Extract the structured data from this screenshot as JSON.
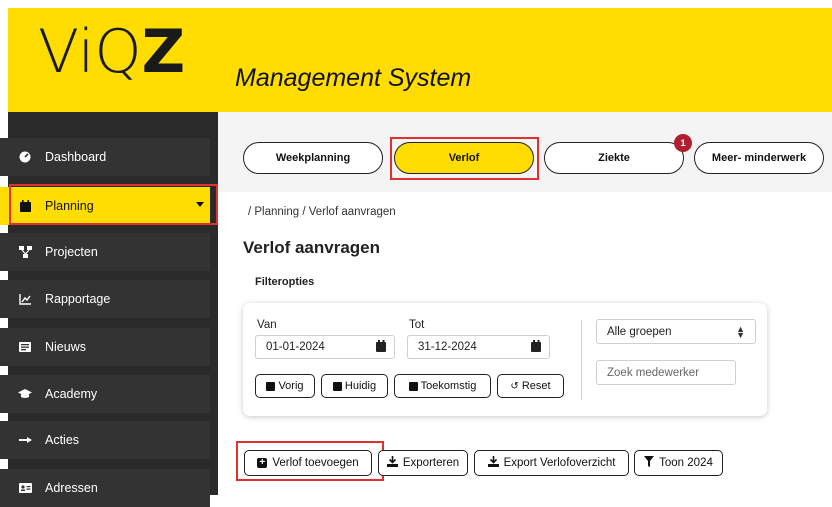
{
  "header": {
    "logo_text_a": "ViQ",
    "logo_text_b": "Z",
    "subtitle": "Management System"
  },
  "sidebar": {
    "items": [
      {
        "label": "Dashboard",
        "icon": "dashboard-icon"
      },
      {
        "label": "Planning",
        "icon": "calendar-icon",
        "active": true
      },
      {
        "label": "Projecten",
        "icon": "sitemap-icon"
      },
      {
        "label": "Rapportage",
        "icon": "chart-icon"
      },
      {
        "label": "Nieuws",
        "icon": "newspaper-icon"
      },
      {
        "label": "Academy",
        "icon": "graduation-cap-icon"
      },
      {
        "label": "Acties",
        "icon": "hand-pointer-icon"
      },
      {
        "label": "Adressen",
        "icon": "address-card-icon"
      }
    ]
  },
  "tabs": [
    {
      "label": "Weekplanning"
    },
    {
      "label": "Verlof",
      "active": true
    },
    {
      "label": "Ziekte",
      "badge": "1"
    },
    {
      "label": "Meer- minderwerk"
    }
  ],
  "breadcrumb": "/ Planning / Verlof aanvragen",
  "page_title": "Verlof aanvragen",
  "filters": {
    "title": "Filteropties",
    "van_label": "Van",
    "van_value": "01-01-2024",
    "tot_label": "Tot",
    "tot_value": "31-12-2024",
    "buttons": {
      "vorig": "Vorig",
      "huidig": "Huidig",
      "toekomstig": "Toekomstig",
      "reset": "Reset"
    },
    "group_select": "Alle groepen",
    "search_placeholder": "Zoek medewerker"
  },
  "actions": {
    "add": "Verlof toevoegen",
    "export": "Exporteren",
    "export_overview": "Export Verlofoverzicht",
    "show_year": "Toon 2024"
  },
  "colors": {
    "brand_yellow": "#ffdd00",
    "sidebar_dark": "#333333",
    "badge_red": "#b01e2f",
    "highlight_red": "#e03030"
  }
}
